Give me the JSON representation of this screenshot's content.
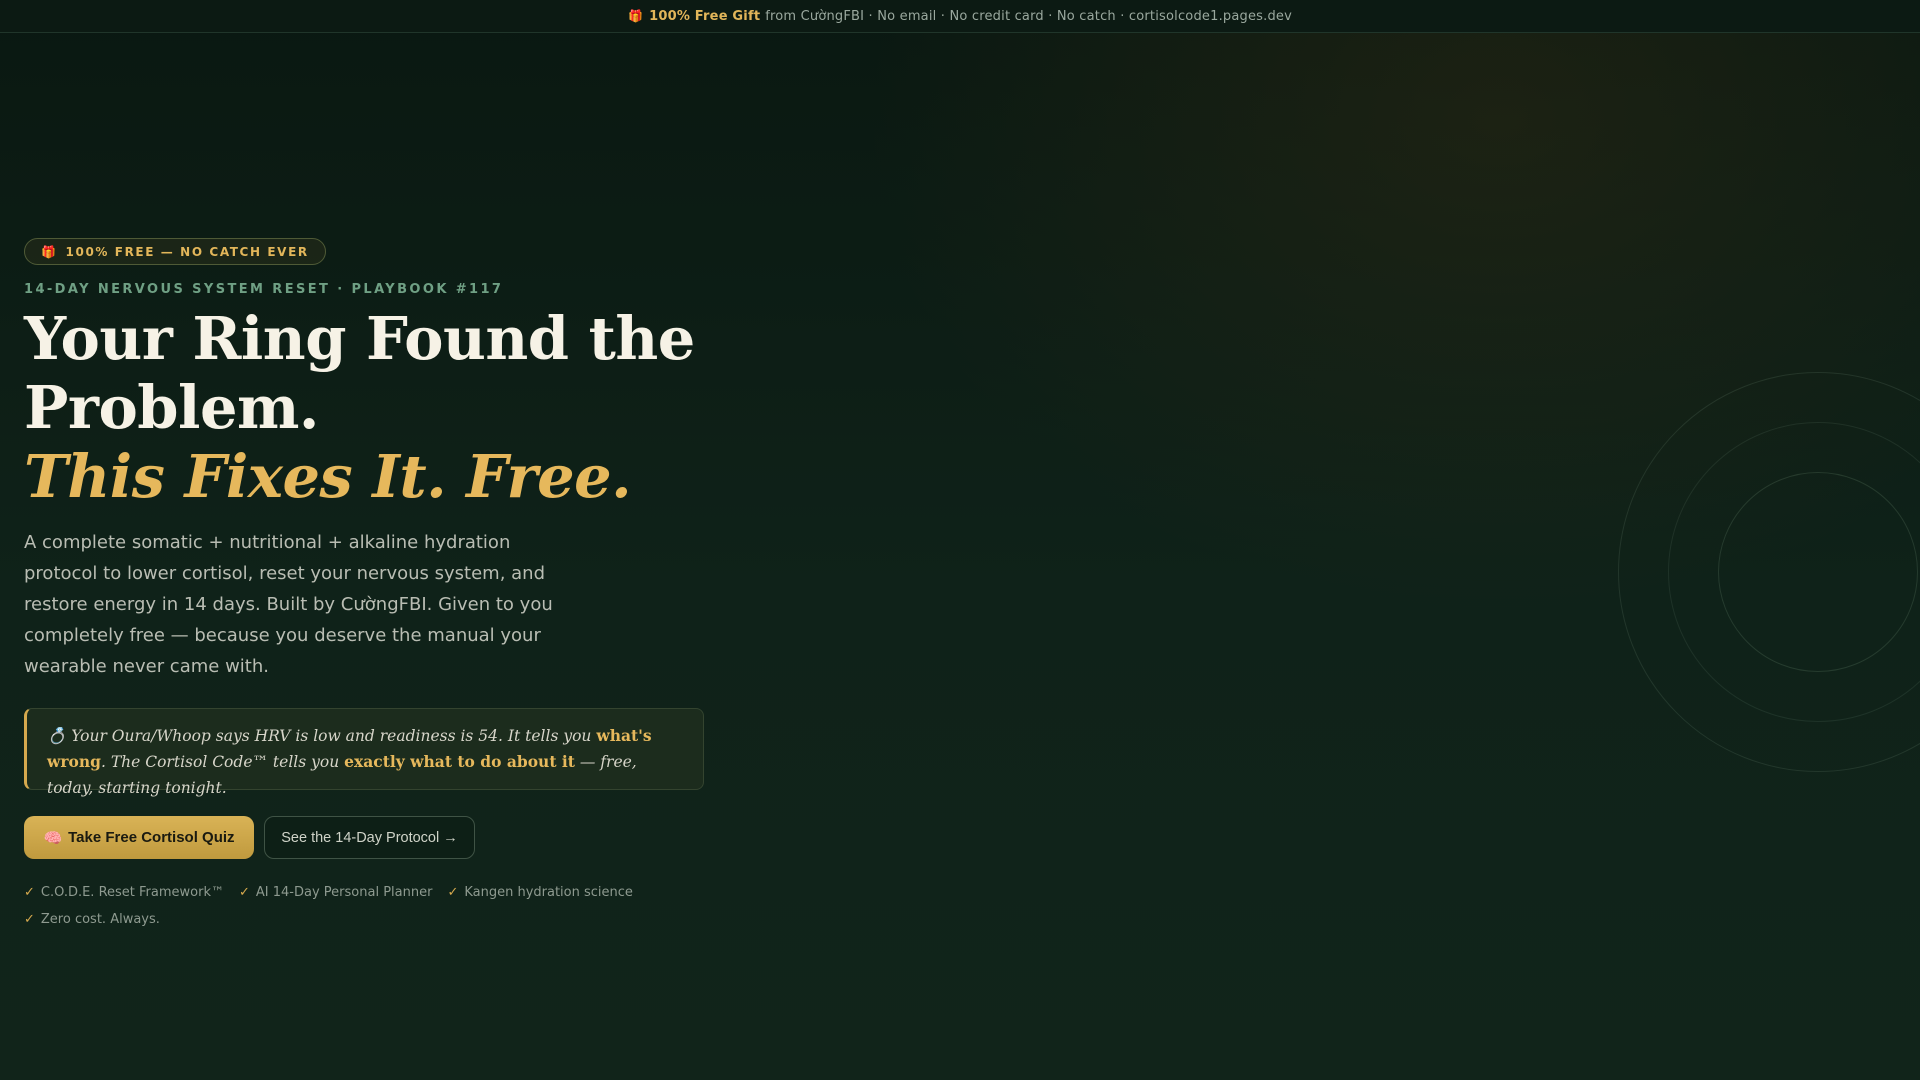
{
  "topbar": {
    "gift_icon": "🎁",
    "highlight": "100% Free Gift",
    "rest": "from CườngFBI · No email · No credit card · No catch · cortisolcode1.pages.dev"
  },
  "hero": {
    "badge": {
      "icon": "🎁",
      "text": "100% FREE — NO CATCH EVER"
    },
    "eyebrow": "14-DAY NERVOUS SYSTEM RESET · PLAYBOOK #117",
    "headline": {
      "line1": "Your Ring Found the",
      "line2": "Problem.",
      "line3": "This Fixes It. Free."
    },
    "lead": "A complete somatic + nutritional + alkaline hydration protocol to lower cortisol, reset your nervous system, and restore energy in 14 days. Built by CườngFBI. Given to you completely free — because you deserve the manual your wearable never came with.",
    "callout": {
      "icon": "💍",
      "part1": "Your Oura/Whoop says HRV is low and readiness is 54. It tells you",
      "hl1": "what's wrong",
      "part2": ". The Cortisol Code™ tells you",
      "hl2": "exactly what to do about it",
      "part3": "— free, today, starting tonight."
    },
    "buttons": {
      "primary_icon": "🧠",
      "primary_label": "Take Free Cortisol Quiz",
      "secondary_label": "See the 14-Day Protocol →"
    },
    "features": [
      "C.O.D.E. Reset Framework™",
      "AI 14-Day Personal Planner",
      "Kangen hydration science",
      "Zero cost. Always."
    ],
    "check_glyph": "✓"
  },
  "colors": {
    "background": "#0b1a13",
    "accent_gold": "#e6b85c",
    "eyebrow_green": "#6fa084",
    "headline_white": "#f6f2e6"
  }
}
